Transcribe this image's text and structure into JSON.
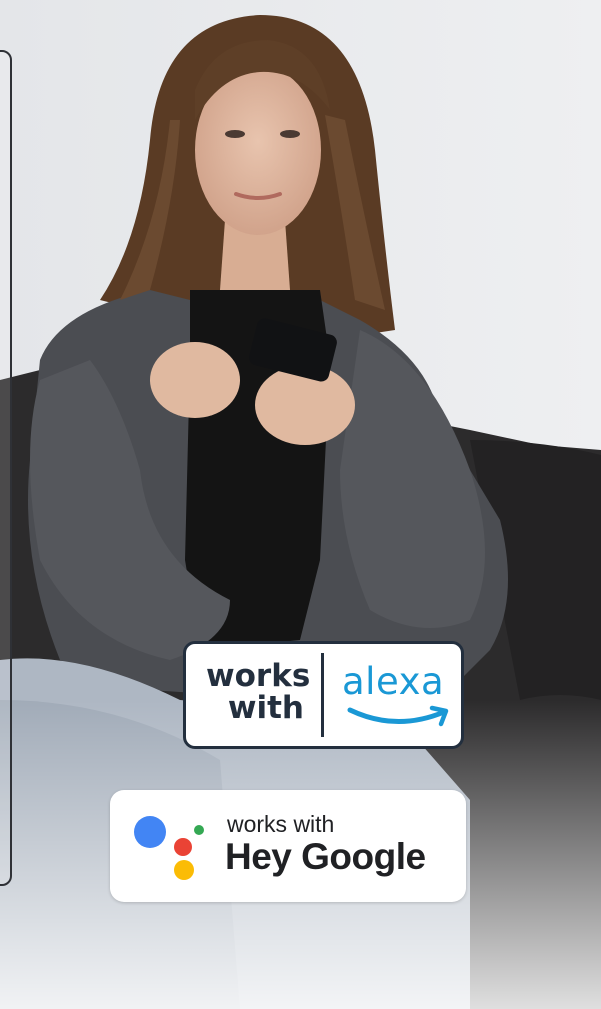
{
  "badges": {
    "alexa": {
      "works_with": "works with",
      "brand": "alexa"
    },
    "google": {
      "works_with": "works with",
      "brand": "Hey Google"
    }
  },
  "colors": {
    "alexa_blue": "#1a98d5",
    "alexa_dark": "#232f3e",
    "google_blue": "#4285f4",
    "google_red": "#ea4335",
    "google_yellow": "#fbbc05",
    "google_green": "#34a853"
  },
  "icons": [
    "alexa-smile-icon",
    "google-assistant-dots-icon"
  ]
}
